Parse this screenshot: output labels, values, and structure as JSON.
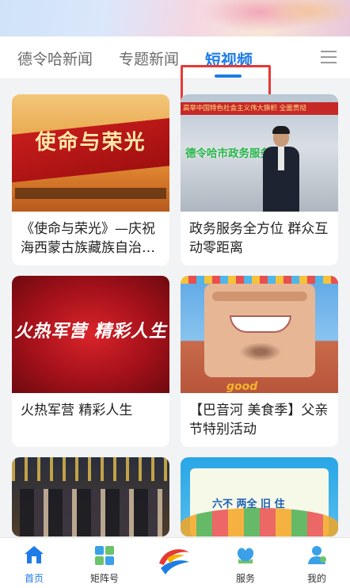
{
  "tabs": {
    "items": [
      {
        "label": "德令哈新闻"
      },
      {
        "label": "专题新闻"
      },
      {
        "label": "短视频"
      }
    ],
    "active_index": 2,
    "menu_icon": "menu-icon"
  },
  "videos": [
    {
      "title": "《使命与荣光》—庆祝海西蒙古族藏族自治…",
      "thumb_text": "使命与荣光"
    },
    {
      "title": "政务服务全方位  群众互动零距离",
      "thumb_banner": "高举中国特色社会主义伟大旗帜  全面贯彻",
      "thumb_text": "德令哈市政务服务中心"
    },
    {
      "title": "火热军营    精彩人生",
      "thumb_text": "火热军营  精彩人生"
    },
    {
      "title": "【巴音河  美食季】父亲节特别活动",
      "thumb_text": "good"
    },
    {
      "title": ""
    },
    {
      "title": "",
      "thumb_text": "六不  两全  旧  住"
    }
  ],
  "bottom_nav": [
    {
      "label": "首页",
      "icon": "home-icon",
      "active": true
    },
    {
      "label": "矩阵号",
      "icon": "matrix-icon",
      "active": false
    },
    {
      "label": "",
      "icon": "app-logo",
      "active": false
    },
    {
      "label": "服务",
      "icon": "service-icon",
      "active": false
    },
    {
      "label": "我的",
      "icon": "profile-icon",
      "active": false
    }
  ],
  "colors": {
    "accent": "#1e7ce6",
    "highlight_box": "#e53935"
  }
}
